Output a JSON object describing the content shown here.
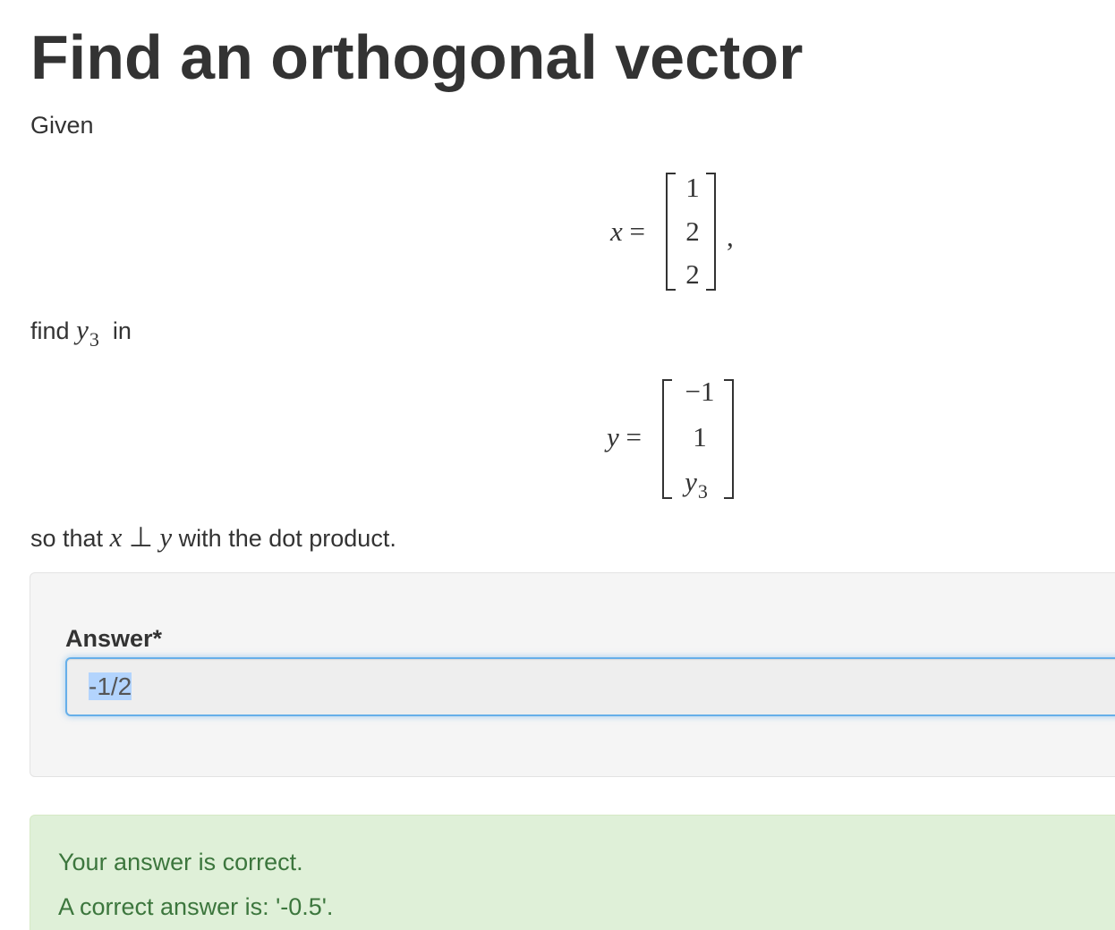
{
  "question": {
    "title": "Find an orthogonal vector",
    "given_text": "Given",
    "x_matrix": {
      "lhs_var": "x",
      "equals": "=",
      "entries": [
        "1",
        "2",
        "2"
      ],
      "trailing": ","
    },
    "find_text": "find",
    "find_var": "y",
    "find_sub": "3",
    "in_text": "in",
    "y_matrix": {
      "lhs_var": "y",
      "equals": "=",
      "entries": [
        "−1",
        "1"
      ],
      "entry3_var": "y",
      "entry3_sub": "3"
    },
    "so_that_text": "so that",
    "cond_x": "x",
    "cond_perp": "⊥",
    "cond_y": "y",
    "dot_product_text": "with the dot product."
  },
  "answer": {
    "label": "Answer*",
    "value": "-1/2"
  },
  "feedback": {
    "status": "Your answer is correct.",
    "correct_answer": "A correct answer is: '-0.5'.",
    "color": "#3c763d",
    "background": "#dff0d8"
  }
}
